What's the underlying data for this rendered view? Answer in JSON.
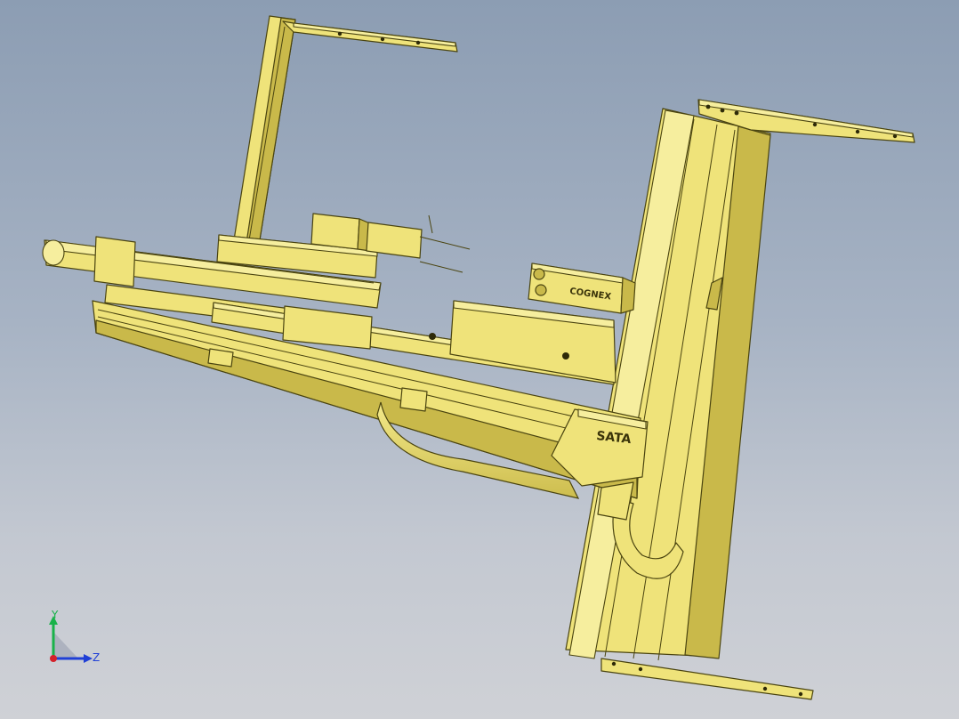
{
  "viewport": {
    "background_top": "#8c9db3",
    "background_bottom": "#cfd1d6",
    "model_color": "#efe37a",
    "edge_color": "#4a4410"
  },
  "model": {
    "labels": {
      "brand_logo": "SATA",
      "camera_brand": "COGNEX"
    }
  },
  "triad": {
    "y_label": "Y",
    "z_label": "Z",
    "y_color": "#19b24a",
    "z_color": "#1f3fd6",
    "x_color": "#d4212a"
  }
}
